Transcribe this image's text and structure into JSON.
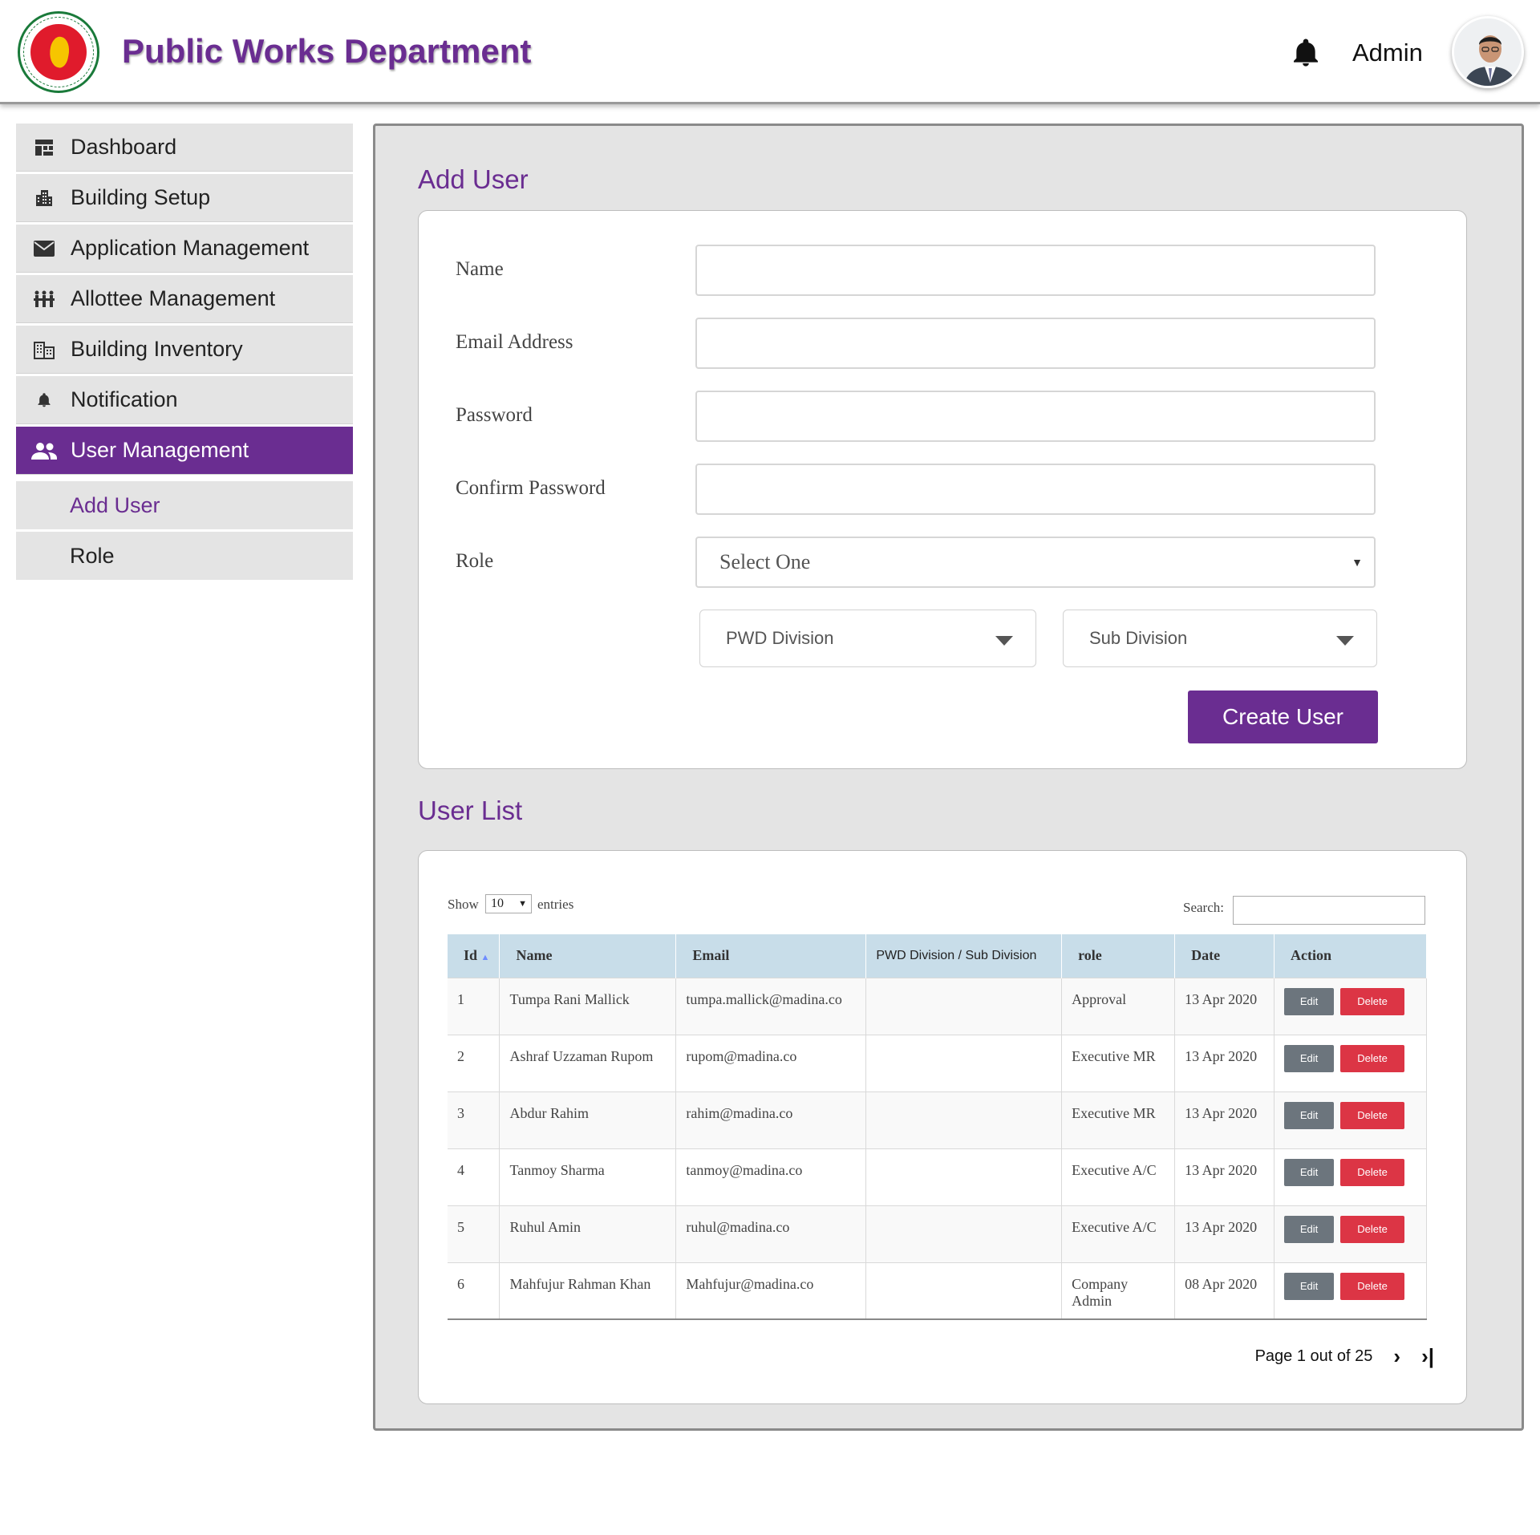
{
  "header": {
    "title": "Public Works Department",
    "user_name": "Admin",
    "icons": {
      "notifications": "bell-icon",
      "avatar": "user-avatar",
      "logo": "government-seal"
    }
  },
  "sidebar": {
    "items": [
      {
        "label": "Dashboard",
        "icon": "dashboard-icon"
      },
      {
        "label": "Building Setup",
        "icon": "building-icon"
      },
      {
        "label": "Application Management",
        "icon": "envelope-icon"
      },
      {
        "label": "Allottee Management",
        "icon": "people-group-icon"
      },
      {
        "label": "Building Inventory",
        "icon": "office-building-icon"
      },
      {
        "label": "Notification",
        "icon": "bell-icon"
      },
      {
        "label": "User Management",
        "icon": "users-icon",
        "active": true
      }
    ],
    "sub_items": [
      {
        "label": "Add User",
        "current": true
      },
      {
        "label": "Role"
      }
    ]
  },
  "add_user": {
    "title": "Add User",
    "fields": {
      "name_label": "Name",
      "email_label": "Email Address",
      "password_label": "Password",
      "confirm_password_label": "Confirm Password",
      "role_label": "Role",
      "role_value": "Select One",
      "pwd_division": "PWD Division",
      "sub_division": "Sub Division"
    },
    "submit_label": "Create User"
  },
  "user_list": {
    "title": "User List",
    "show_label": "Show",
    "entries_value": "10",
    "entries_label": "entries",
    "search_label": "Search:",
    "columns": [
      "Id",
      "Name",
      "Email",
      "PWD Division / Sub Division",
      "role",
      "Date",
      "Action"
    ],
    "rows": [
      {
        "id": "1",
        "name": "Tumpa Rani Mallick",
        "email": "tumpa.mallick@madina.co",
        "division": "",
        "role": "Approval",
        "date": "13 Apr 2020"
      },
      {
        "id": "2",
        "name": "Ashraf Uzzaman Rupom",
        "email": "rupom@madina.co",
        "division": "",
        "role": "Executive MR",
        "date": "13 Apr 2020"
      },
      {
        "id": "3",
        "name": "Abdur Rahim",
        "email": "rahim@madina.co",
        "division": "",
        "role": "Executive MR",
        "date": "13 Apr 2020"
      },
      {
        "id": "4",
        "name": "Tanmoy Sharma",
        "email": "tanmoy@madina.co",
        "division": "",
        "role": "Executive A/C",
        "date": "13 Apr 2020"
      },
      {
        "id": "5",
        "name": "Ruhul Amin",
        "email": "ruhul@madina.co",
        "division": "",
        "role": "Executive A/C",
        "date": "13 Apr 2020"
      },
      {
        "id": "6",
        "name": "Mahfujur Rahman Khan",
        "email": "Mahfujur@madina.co",
        "division": "",
        "role": "Company Admin",
        "date": "08 Apr 2020"
      }
    ],
    "edit_label": "Edit",
    "delete_label": "Delete",
    "pagination": "Page 1 out of 25"
  },
  "colors": {
    "brand": "#6a2d91",
    "table_header": "#c8dde9",
    "edit_button": "#6c757d",
    "delete_button": "#dc3545"
  }
}
